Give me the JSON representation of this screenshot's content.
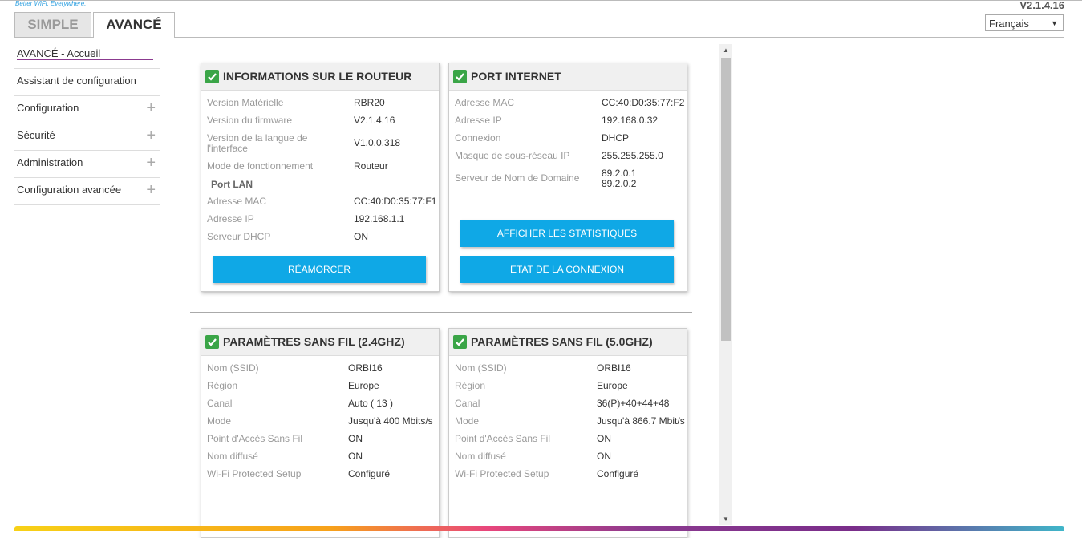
{
  "header": {
    "tagline": "Better WiFi. Everywhere.",
    "version": "V2.1.4.16",
    "language": "Français",
    "tabs": [
      {
        "label": "SIMPLE",
        "active": false
      },
      {
        "label": "AVANCÉ",
        "active": true
      }
    ]
  },
  "sidebar": {
    "items": [
      {
        "label": "AVANCÉ - Accueil",
        "expandable": false,
        "active": true
      },
      {
        "label": "Assistant de configuration",
        "expandable": false
      },
      {
        "label": "Configuration",
        "expandable": true
      },
      {
        "label": "Sécurité",
        "expandable": true
      },
      {
        "label": "Administration",
        "expandable": true
      },
      {
        "label": "Configuration avancée",
        "expandable": true
      }
    ]
  },
  "router_info": {
    "title": "INFORMATIONS SUR LE ROUTEUR",
    "rows": [
      {
        "label": "Version Matérielle",
        "value": "RBR20"
      },
      {
        "label": "Version du firmware",
        "value": "V2.1.4.16"
      },
      {
        "label": "Version de la langue de l'interface",
        "value": "V1.0.0.318"
      },
      {
        "label": "Mode de fonctionnement",
        "value": "Routeur"
      }
    ],
    "lan_label": "Port LAN",
    "lan_rows": [
      {
        "label": "Adresse MAC",
        "value": "CC:40:D0:35:77:F1"
      },
      {
        "label": "Adresse IP",
        "value": "192.168.1.1"
      },
      {
        "label": "Serveur DHCP",
        "value": "ON"
      }
    ],
    "button": "RÉAMORCER"
  },
  "internet_port": {
    "title": "PORT INTERNET",
    "rows": [
      {
        "label": "Adresse MAC",
        "value": "CC:40:D0:35:77:F2"
      },
      {
        "label": "Adresse IP",
        "value": "192.168.0.32"
      },
      {
        "label": "Connexion",
        "value": "DHCP"
      },
      {
        "label": "Masque de sous-réseau IP",
        "value": "255.255.255.0"
      },
      {
        "label": "Serveur de Nom de Domaine",
        "value1": "89.2.0.1",
        "value2": "89.2.0.2"
      }
    ],
    "btn_stats": "AFFICHER LES STATISTIQUES",
    "btn_status": "ETAT DE LA CONNEXION"
  },
  "wifi24": {
    "title": "PARAMÈTRES SANS FIL (2.4GHZ)",
    "rows": [
      {
        "label": "Nom (SSID)",
        "value": "ORBI16"
      },
      {
        "label": "Région",
        "value": "Europe"
      },
      {
        "label": "Canal",
        "value": "Auto ( 13 )"
      },
      {
        "label": "Mode",
        "value": "Jusqu'à 400 Mbits/s"
      },
      {
        "label": "Point d'Accès Sans Fil",
        "value": "ON"
      },
      {
        "label": "Nom diffusé",
        "value": "ON"
      },
      {
        "label": "Wi-Fi Protected Setup",
        "value": "Configuré"
      }
    ]
  },
  "wifi5": {
    "title": "PARAMÈTRES SANS FIL (5.0GHZ)",
    "rows": [
      {
        "label": "Nom (SSID)",
        "value": "ORBI16"
      },
      {
        "label": "Région",
        "value": "Europe"
      },
      {
        "label": "Canal",
        "value": "36(P)+40+44+48"
      },
      {
        "label": "Mode",
        "value": "Jusqu'à 866.7 Mbit/s"
      },
      {
        "label": "Point d'Accès Sans Fil",
        "value": "ON"
      },
      {
        "label": "Nom diffusé",
        "value": "ON"
      },
      {
        "label": "Wi-Fi Protected Setup",
        "value": "Configuré"
      }
    ]
  },
  "colors": {
    "accent_blue": "#0fa8e6",
    "check_green": "#3aa547",
    "active_underline": "#8b3a8f"
  }
}
